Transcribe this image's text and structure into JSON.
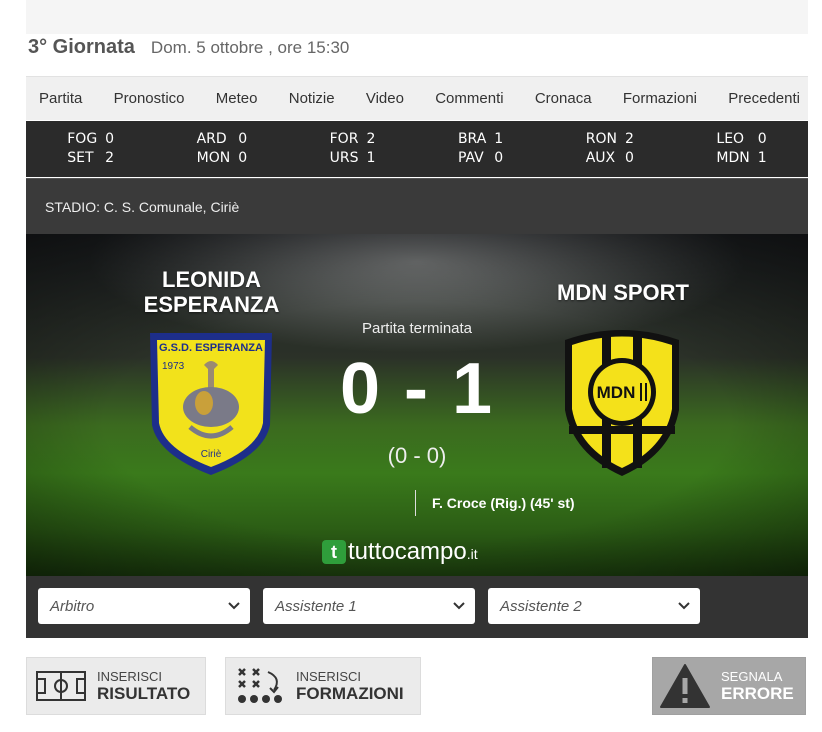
{
  "header": {
    "round": "3° Giornata",
    "date": "Dom. 5 ottobre , ore 15:30"
  },
  "tabs": [
    "Partita",
    "Pronostico",
    "Meteo",
    "Notizie",
    "Video",
    "Commenti",
    "Cronaca",
    "Formazioni",
    "Precedenti"
  ],
  "ticker": [
    {
      "home": "FOG",
      "home_score": "0",
      "away": "SET",
      "away_score": "2"
    },
    {
      "home": "ARD",
      "home_score": "0",
      "away": "MON",
      "away_score": "0"
    },
    {
      "home": "FOR",
      "home_score": "2",
      "away": "URS",
      "away_score": "1"
    },
    {
      "home": "BRA",
      "home_score": "1",
      "away": "PAV",
      "away_score": "0"
    },
    {
      "home": "RON",
      "home_score": "2",
      "away": "AUX",
      "away_score": "0"
    },
    {
      "home": "LEO",
      "home_score": "0",
      "away": "MDN",
      "away_score": "1"
    }
  ],
  "stadium": "STADIO: C. S. Comunale, Ciriè",
  "match": {
    "home_line1": "LEONIDA",
    "home_line2": "ESPERANZA",
    "away_name": "MDN SPORT",
    "status": "Partita terminata",
    "score": "0 - 1",
    "halftime": "(0 - 0)",
    "scorer": "F. Croce (Rig.) (45' st)",
    "home_crest_top": "G.S.D. ESPERANZA",
    "home_crest_year": "1973",
    "home_crest_city": "Ciriè",
    "away_crest_text": "MDN",
    "home_crest_colors": {
      "shield": "#f2e21b",
      "border": "#1d2e8a"
    },
    "away_crest_colors": {
      "fill": "#f4e11a",
      "stripes": "#111111"
    }
  },
  "brand": {
    "mark": "t",
    "name": "tuttocampo",
    "tld": ".it"
  },
  "officials": [
    "Arbitro",
    "Assistente 1",
    "Assistente 2"
  ],
  "actions": {
    "result_small": "INSERISCI",
    "result_big": "RISULTATO",
    "lineups_small": "INSERISCI",
    "lineups_big": "FORMAZIONI",
    "report_small": "SEGNALA",
    "report_big": "ERRORE"
  }
}
